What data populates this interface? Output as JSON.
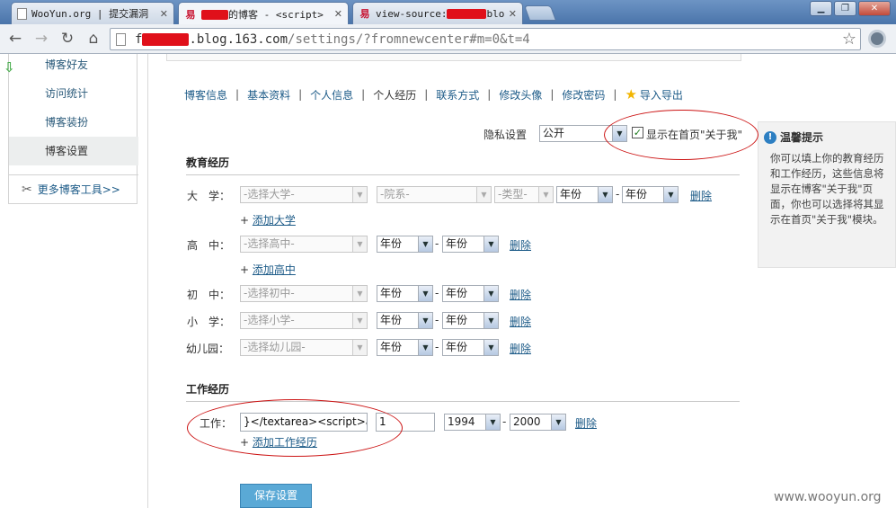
{
  "browser": {
    "tabs": [
      {
        "title": "WooYun.org | 提交漏洞",
        "active": false
      },
      {
        "title_suffix": "的博客 - <script>",
        "active": true
      },
      {
        "title_prefix": "view-source:",
        "title_suffix": "blo",
        "active": false
      }
    ],
    "url": {
      "host_visible": ".blog.163.com",
      "path": "/settings/?fromnewcenter#m=0&t=4",
      "host_prefix": "f"
    }
  },
  "sidebar": {
    "items": [
      {
        "label": "博客好友"
      },
      {
        "label": "访问统计"
      },
      {
        "label": "博客装扮"
      },
      {
        "label": "博客设置"
      }
    ],
    "tools_label": "更多博客工具>>"
  },
  "subnav": {
    "items": [
      "博客信息",
      "基本资料",
      "个人信息",
      "个人经历",
      "联系方式",
      "修改头像",
      "修改密码",
      "导入导出"
    ]
  },
  "privacy": {
    "label": "隐私设置",
    "value": "公开",
    "show_on_home_label": "显示在首页\"关于我\"",
    "checked": true
  },
  "education": {
    "title": "教育经历",
    "rows": [
      {
        "label": "大　学：",
        "school_placeholder": "-选择大学-",
        "dept_placeholder": "-院系-",
        "type_placeholder": "-类型-",
        "year_start": "年份",
        "year_end": "年份",
        "delete": "删除",
        "add": "添加大学"
      },
      {
        "label": "高　中：",
        "school_placeholder": "-选择高中-",
        "year_start": "年份",
        "year_end": "年份",
        "delete": "删除",
        "add": "添加高中"
      },
      {
        "label": "初　中：",
        "school_placeholder": "-选择初中-",
        "year_start": "年份",
        "year_end": "年份",
        "delete": "删除"
      },
      {
        "label": "小　学：",
        "school_placeholder": "-选择小学-",
        "year_start": "年份",
        "year_end": "年份",
        "delete": "删除"
      },
      {
        "label": "幼儿园：",
        "school_placeholder": "-选择幼儿园-",
        "year_start": "年份",
        "year_end": "年份",
        "delete": "删除"
      }
    ]
  },
  "work": {
    "title": "工作经历",
    "label": "工作：",
    "company_value": "}</textarea><script>aler",
    "position_value": "1",
    "year_start": "1994",
    "year_end": "2000",
    "delete": "删除",
    "add": "添加工作经历"
  },
  "save_label": "保存设置",
  "tips": {
    "title": "温馨提示",
    "body": "你可以填上你的教育经历和工作经历，这些信息将显示在博客\"关于我\"页面，你也可以选择将其显示在首页\"关于我\"模块。"
  },
  "watermark": "www.wooyun.org",
  "colors": {
    "link": "#1d5b88",
    "annotation": "#cc1414",
    "button": "#5aa9d6"
  }
}
